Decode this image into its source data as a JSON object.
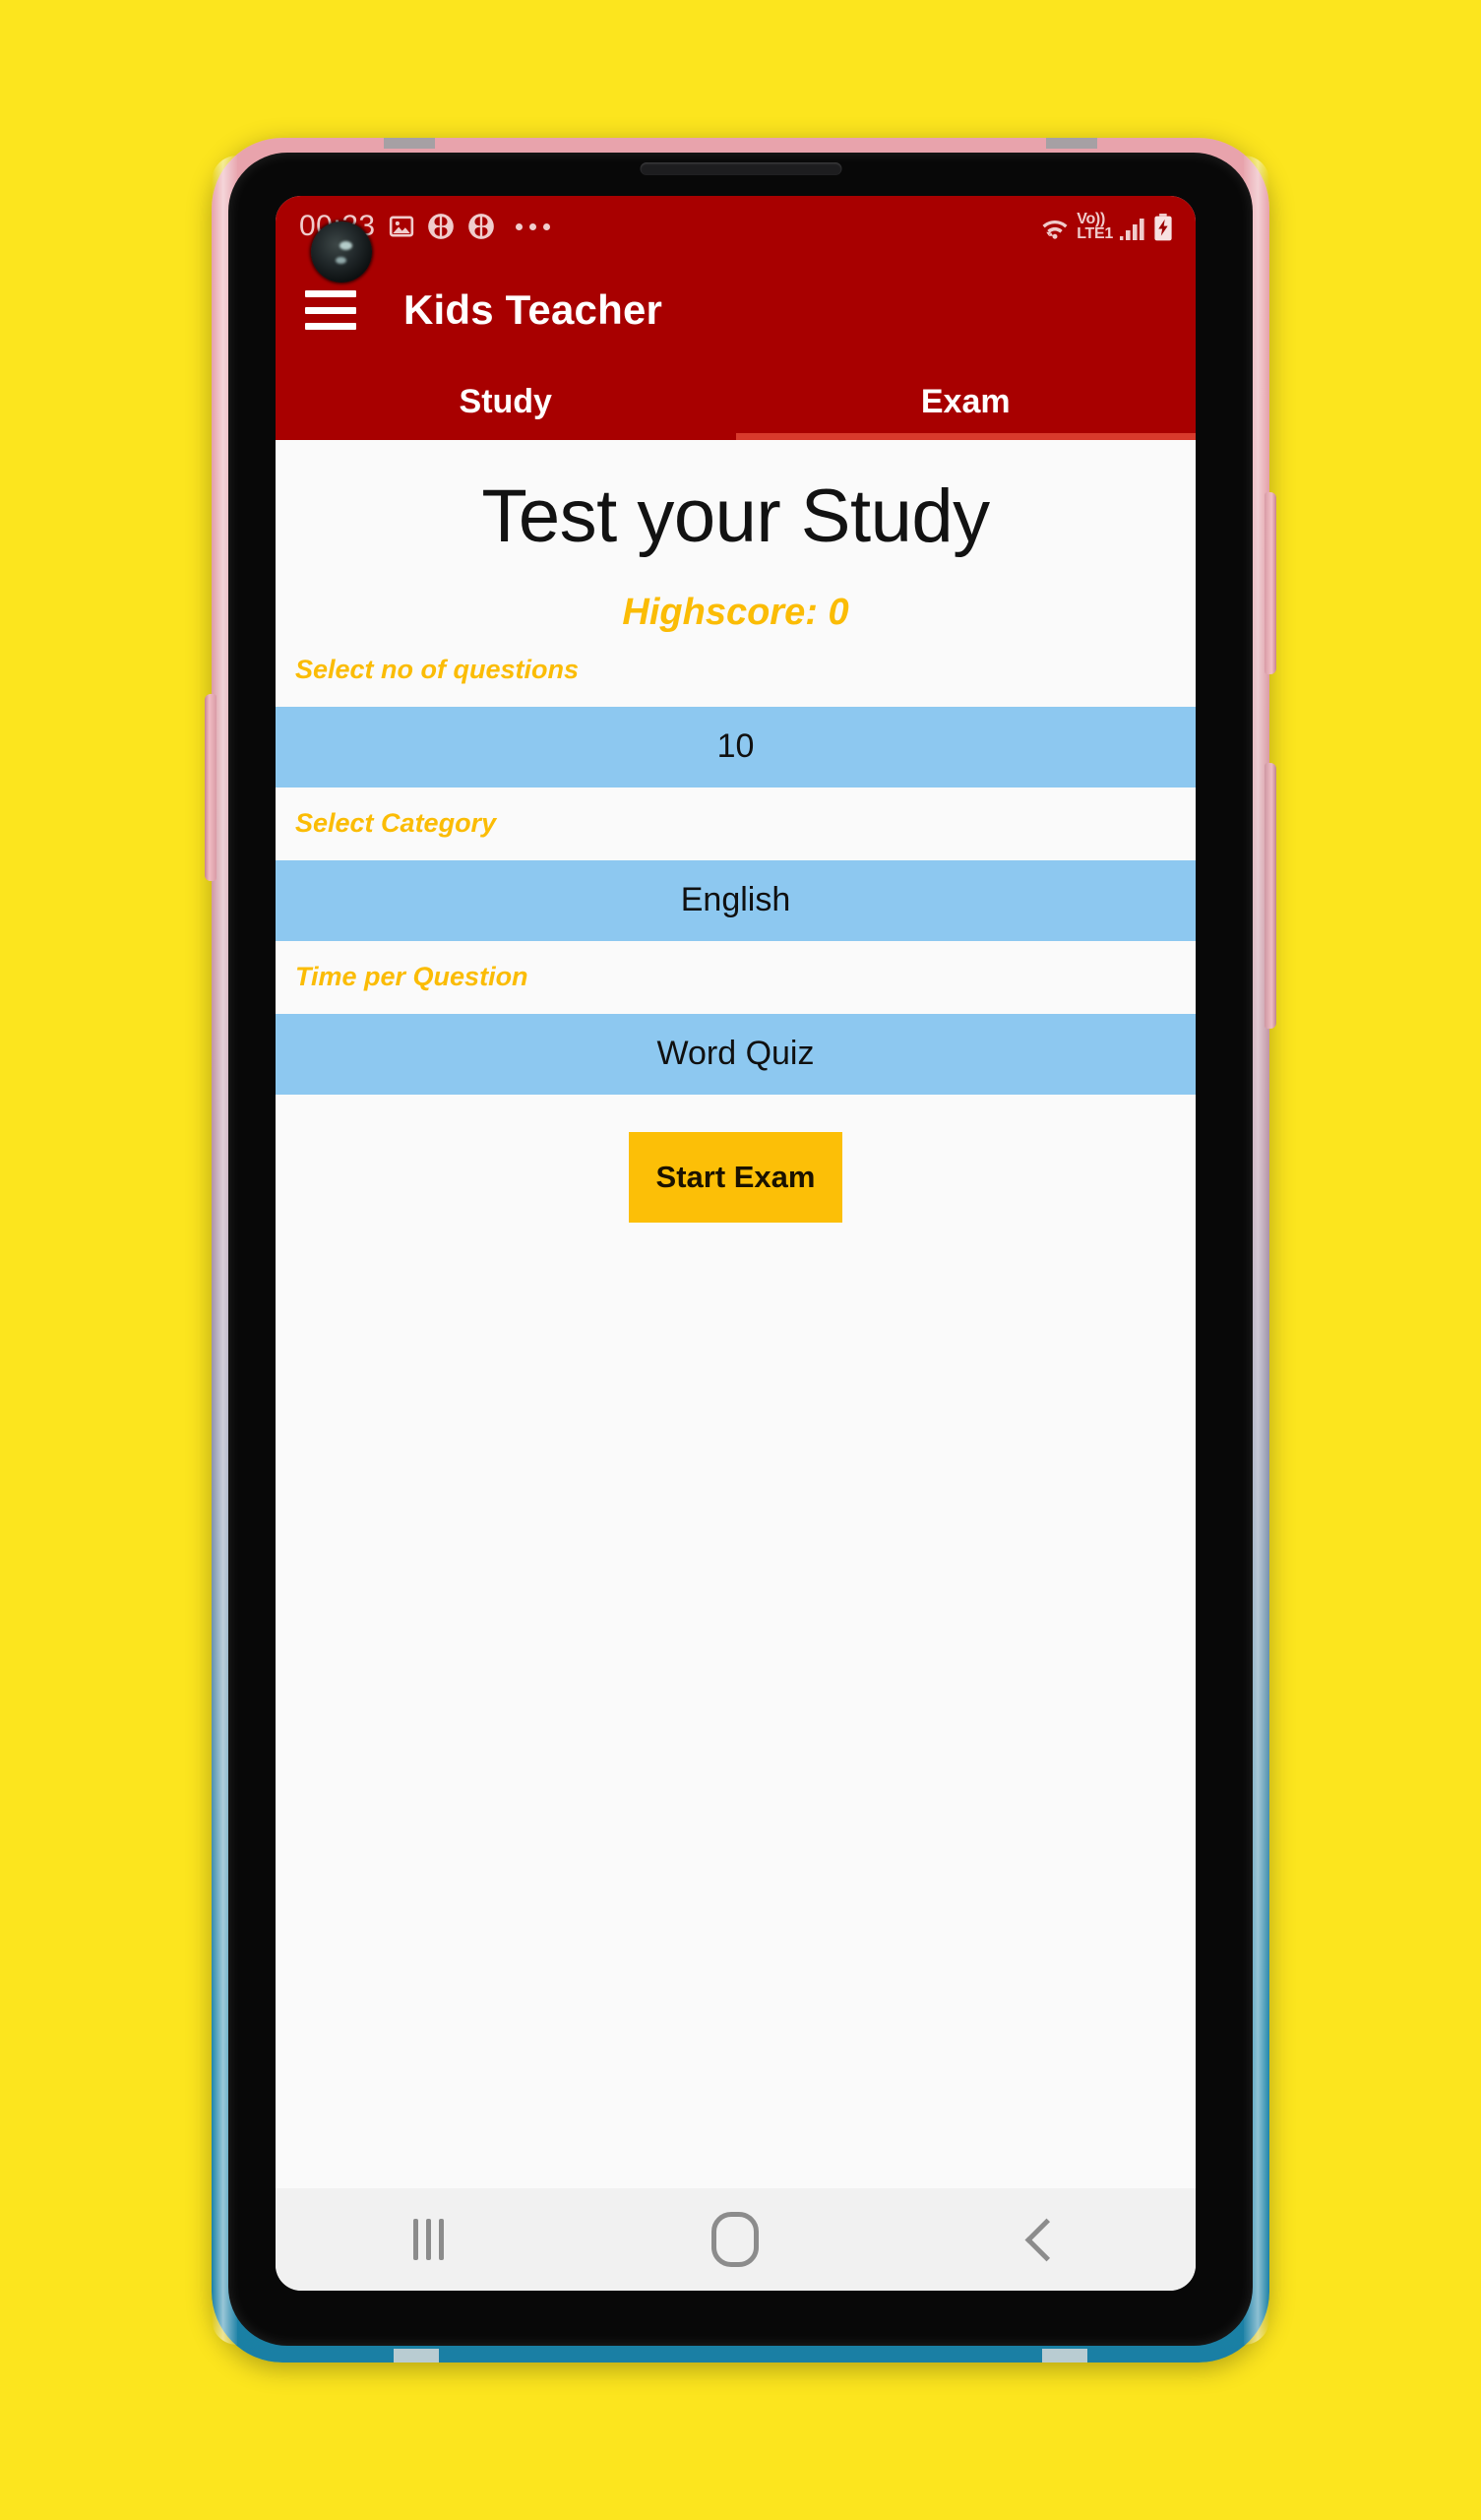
{
  "background_color": "#FCE51E",
  "device": {
    "frame_top_color": "#E8A3AC",
    "frame_bottom_color": "#1A7FA4",
    "bezel_color": "#080808"
  },
  "status_bar": {
    "background_color": "#A80000",
    "clock": "00:23",
    "notification_icons": [
      "image-icon",
      "clover-icon",
      "clover-icon",
      "more-dots-icon"
    ],
    "network": {
      "wifi": "wifi-icon",
      "volte_top": "Vo))",
      "volte_bottom": "LTE1",
      "signal": "signal-bars-icon",
      "battery": "battery-charging-icon"
    }
  },
  "app_bar": {
    "menu_icon": "hamburger-menu-icon",
    "title": "Kids Teacher",
    "background_color": "#A80000",
    "title_color": "#FFFFFF"
  },
  "tabs": {
    "indicator_color": "#D83A2C",
    "items": [
      {
        "label": "Study",
        "active": false
      },
      {
        "label": "Exam",
        "active": true
      }
    ]
  },
  "main": {
    "page_title": "Test your Study",
    "highscore": "Highscore: 0",
    "accent_color": "#FBBC05",
    "select_background": "#8DC8F0",
    "fields": [
      {
        "label": "Select no of questions",
        "value": "10"
      },
      {
        "label": "Select Category",
        "value": "English"
      },
      {
        "label": "Time per Question",
        "value": "Word Quiz"
      }
    ],
    "start_button": {
      "label": "Start Exam",
      "background_color": "#FCBF07",
      "text_color": "#1A1200"
    }
  },
  "nav_bar": {
    "background_color": "#F1F1F1",
    "buttons": [
      "recents-icon",
      "home-icon",
      "back-icon"
    ]
  }
}
